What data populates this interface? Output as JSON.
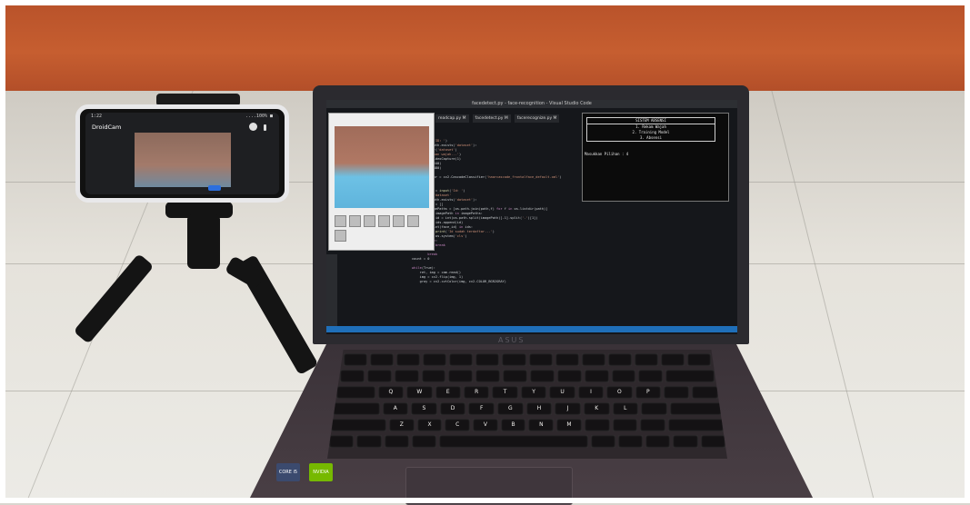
{
  "scene": {
    "description_colors": {
      "wall": "#c65e30",
      "floor": "#e5e2db",
      "laptop_body": "#3a3238",
      "statusbar": "#1f6fb9"
    }
  },
  "phone": {
    "status_time": "1:22",
    "status_right": "....100% ■",
    "app_title": "DroidCam",
    "icons": [
      "brightness-icon",
      "more-icon"
    ]
  },
  "laptop": {
    "brand": "ASUS",
    "titlebar": "facedetect.py - face-recognition - Visual Studio Code",
    "tabs": [
      {
        "label": "readcap.py M"
      },
      {
        "label": "facedetect.py M"
      },
      {
        "label": "facerecognize.py M"
      }
    ],
    "menu": {
      "header": "SISTEM ABSENSI",
      "items": [
        "1. Rekam Wajah",
        "2. Training Model",
        "3. Absensi"
      ],
      "prompt": "Masukkan Pilihan : 4"
    },
    "keys_row1": [
      "Q",
      "W",
      "E",
      "R",
      "T",
      "Y",
      "U",
      "I",
      "O",
      "P"
    ],
    "keys_row2": [
      "A",
      "S",
      "D",
      "F",
      "G",
      "H",
      "J",
      "K",
      "L"
    ],
    "keys_row3": [
      "Z",
      "X",
      "C",
      "V",
      "B",
      "N",
      "M"
    ],
    "sticker_intel": "CORE i5",
    "sticker_nvidia": "NVIDIA"
  }
}
